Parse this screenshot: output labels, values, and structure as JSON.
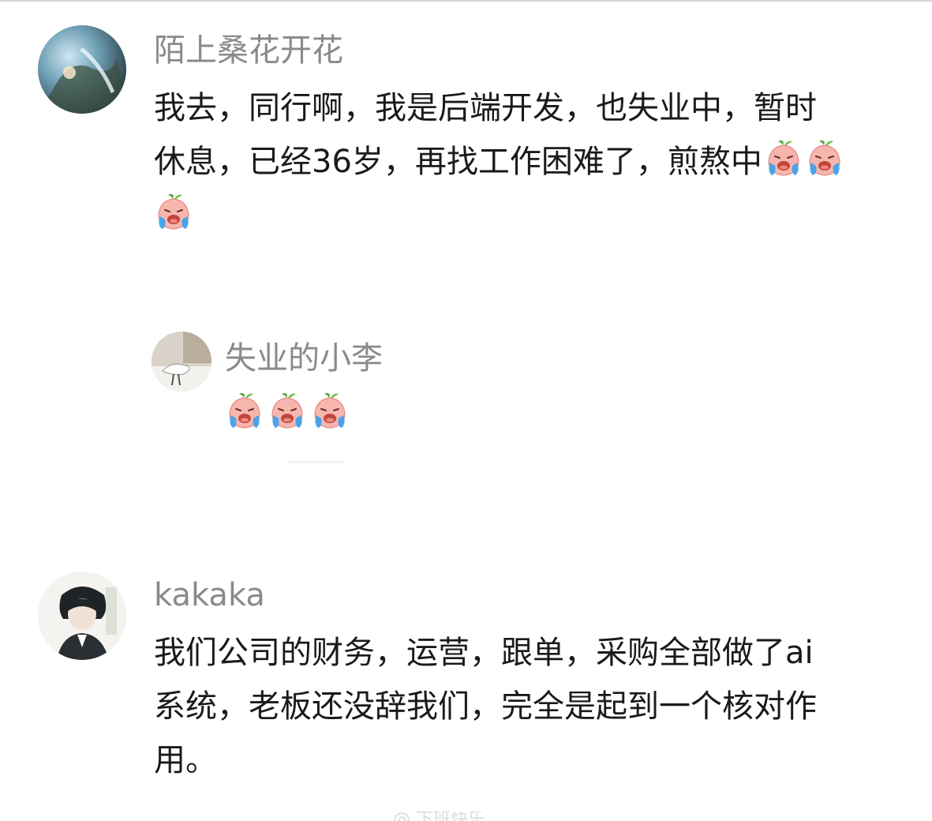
{
  "comments": [
    {
      "username": "陌上桑花开花",
      "lines": [
        "我去，同行啊，我是后端开发，也失业中，暂时",
        "休息，已经36岁，再找工作困难了，煎熬中"
      ],
      "emojis_inline": [
        "crying-peach-emoji",
        "crying-peach-emoji"
      ],
      "emojis_after": [
        "crying-peach-emoji"
      ]
    },
    {
      "username": "失业的小李",
      "emojis": [
        "crying-peach-emoji",
        "crying-peach-emoji",
        "crying-peach-emoji"
      ]
    },
    {
      "username": "kakaka",
      "lines": [
        "我们公司的财务，运营，跟单，采购全部做了ai",
        "系统，老板还没辞我们，完全是起到一个核对作",
        "用。"
      ]
    }
  ],
  "watermark": "@ 下班快乐",
  "colors": {
    "username": "#8a8a8a",
    "text": "#1a1a1a",
    "background": "#ffffff"
  }
}
